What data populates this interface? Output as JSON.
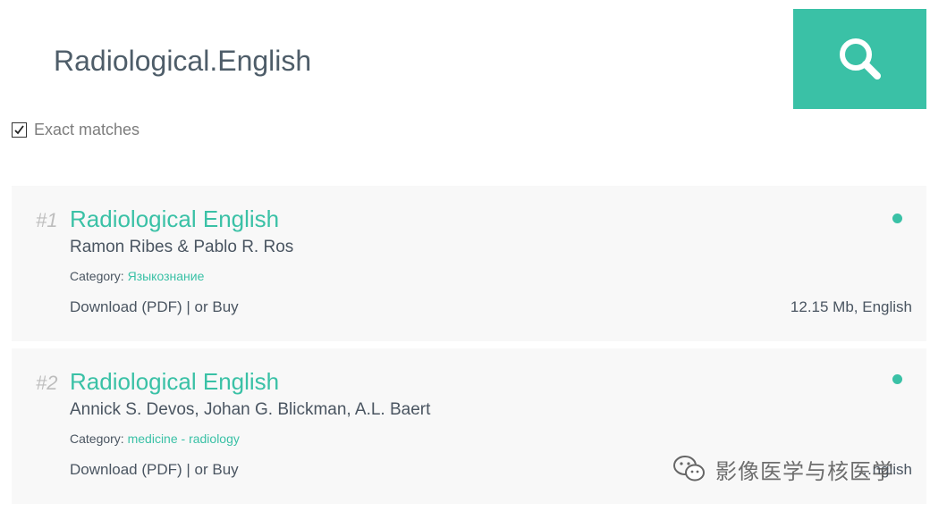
{
  "search": {
    "query": "Radiological.English",
    "exact_label": "Exact matches",
    "exact_checked": true,
    "accent_color": "#3ac1a6"
  },
  "results": [
    {
      "rank": "#1",
      "title": "Radiological English",
      "authors": "Ramon Ribes & Pablo R. Ros",
      "category_prefix": "Category: ",
      "category": "Языкознание",
      "download": "Download (PDF)",
      "separator": " | ",
      "buy": "or Buy",
      "meta": "12.15 Mb, English"
    },
    {
      "rank": "#2",
      "title": "Radiological English",
      "authors": "Annick S. Devos, Johan G. Blickman, A.L. Baert",
      "category_prefix": "Category: ",
      "category": "medicine - radiology",
      "download": "Download (PDF)",
      "separator": " | ",
      "buy": "or Buy",
      "meta": "…nglish"
    }
  ],
  "watermark": {
    "icon": "wechat-icon",
    "text": "影像医学与核医学"
  }
}
